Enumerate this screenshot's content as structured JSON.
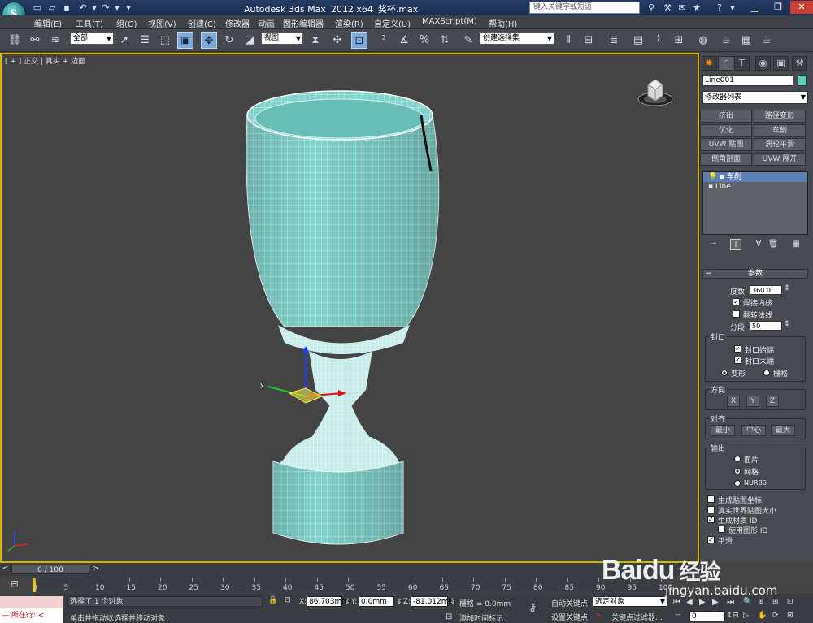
{
  "window": {
    "app": "Autodesk 3ds Max",
    "version": "2012 x64",
    "file": "奖杯.max",
    "search_placeholder": "键入关键字或短语"
  },
  "menus": [
    "编辑(E)",
    "工具(T)",
    "组(G)",
    "视图(V)",
    "创建(C)",
    "修改器",
    "动画",
    "图形编辑器",
    "渲染(R)",
    "自定义(U)",
    "MAXScript(M)",
    "帮助(H)"
  ],
  "toolbar": {
    "selection_filter": "全部",
    "ref_coord": "视图",
    "named_selection": "创建选择集"
  },
  "viewport": {
    "label": "[ + ] 正交 | 真实 + 边面"
  },
  "panel": {
    "object_name": "Line001",
    "object_color": "#5ad3b2",
    "modifier_list": "修改器列表",
    "mod_buttons": [
      "挤出",
      "路径变形",
      "优化",
      "车削",
      "UVW 贴图",
      "涡轮平滑",
      "倒角剖面",
      "UVW 展开"
    ],
    "stack": [
      "车削",
      "Line"
    ],
    "params_title": "参数",
    "degrees_label": "度数:",
    "degrees": "360.0",
    "weld_core": "焊接内核",
    "flip_normals": "翻转法线",
    "segments_label": "分段:",
    "segments": "50",
    "capping_title": "封口",
    "cap_start": "封口始端",
    "cap_end": "封口末端",
    "morph": "变形",
    "grid": "栅格",
    "direction_title": "方向",
    "dir": [
      "X",
      "Y",
      "Z"
    ],
    "align_title": "对齐",
    "align": [
      "最小",
      "中心",
      "最大"
    ],
    "output_title": "输出",
    "out": [
      "面片",
      "网格",
      "NURBS"
    ],
    "gen_map": "生成贴图坐标",
    "real_world": "真实世界贴图大小",
    "gen_mat": "生成材质 ID",
    "use_shape": "使用图形 ID",
    "smooth": "平滑"
  },
  "timeline": {
    "frame": "0 / 100",
    "ticks": [
      "0",
      "5",
      "10",
      "15",
      "20",
      "25",
      "30",
      "35",
      "40",
      "45",
      "50",
      "55",
      "60",
      "65",
      "70",
      "75",
      "80",
      "85",
      "90",
      "95",
      "100"
    ]
  },
  "status": {
    "maxscript": "所在行:",
    "selected": "选择了 1 个对象",
    "hint": "单击并拖动以选择并移动对象",
    "x_label": "X:",
    "x": "86.703mm",
    "y_label": "Y:",
    "y": "0.0mm",
    "z_label": "Z:",
    "z": "-81.012mm",
    "grid": "栅格 = 0.0mm",
    "auto_key": "自动关键点",
    "set_key": "设置关键点",
    "key_mode": "选定对象",
    "key_filters": "关键点过滤器...",
    "add_time_tag": "添加时间标记",
    "frame_field": "0"
  },
  "watermark": {
    "brand": "Baidu",
    "brand_cn": "经验",
    "url": "jingyan.baidu.com"
  }
}
